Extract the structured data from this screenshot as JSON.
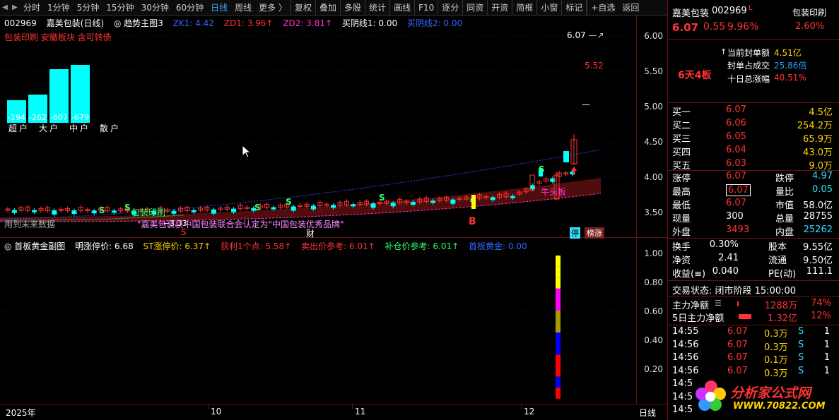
{
  "toolbar": {
    "items": [
      "分时",
      "1分钟",
      "5分钟",
      "15分钟",
      "30分钟",
      "60分钟",
      "日线",
      "周线",
      "更多 〉",
      "复权",
      "叠加",
      "多股",
      "统计",
      "画线",
      "F10",
      "逐分",
      "同资",
      "开资",
      "简框",
      "小窗",
      "标记",
      "+自选",
      "返回"
    ],
    "active_index": 6
  },
  "main_legend": {
    "code": "002969",
    "name": "嘉美包装(日线)",
    "indicator": "趋势主图3",
    "zk1": "ZK1: 4.42",
    "zd1": "ZD1: 3.96↑",
    "zd2": "ZD2: 3.81↑",
    "buy1": "买阴线1: 0.00",
    "buy2": "买阴线2: 0.00",
    "tags": "包装印刷 安徽板块 含可转债"
  },
  "volume_bars": {
    "values": [
      "-194",
      "-262",
      "-607",
      "-679"
    ],
    "labels": [
      "超户",
      "大户",
      "中户",
      "散户"
    ]
  },
  "price_axis": [
    "6.00",
    "5.50",
    "5.00",
    "4.50",
    "4.00",
    "3.50"
  ],
  "main_annotations": {
    "high_label": "6.07",
    "mark_552": "5.52",
    "low_label": "3.33",
    "news": "\"嘉美包装获中国包装联合会认定为\"中国包装优秀品牌\"",
    "future_data": "用到未来数据",
    "print_tag": "包装印刷",
    "b_marker": "B",
    "cai_marker": "财",
    "ting_badge": "停",
    "bangzhang_badge": "榜涨",
    "niu_tag": "牛头板",
    "s_marker": "S"
  },
  "sub_legend": {
    "name": "首板黄金副图",
    "mzt": "明涨停价: 6.68",
    "st": "ST涨停价: 6.37↑",
    "win": "获利1个点: 5.58↑",
    "sell": "卖出价参考: 6.01↑",
    "add": "补仓价参考: 6.01↑",
    "gold": "首板黄金: 0.00"
  },
  "sub_axis": [
    "1.00",
    "0.80",
    "0.60",
    "0.40",
    "0.20"
  ],
  "date_axis": {
    "year": "2025年",
    "m10": "10",
    "m11": "11",
    "m12": "12",
    "period": "日线"
  },
  "stock": {
    "name": "嘉美包装",
    "code": "002969",
    "flag": "L",
    "industry": "包装印刷",
    "price": "6.07",
    "change": "0.55",
    "pct": "9.96%",
    "ind_pct": "2.60%"
  },
  "limit_info": {
    "board": "6天4板",
    "seal_label": "当前封单额",
    "seal_value": "4.51亿",
    "ratio_label": "封单占成交",
    "ratio_value": "25.86倍",
    "ten_label": "十日总涨幅",
    "ten_value": "40.51%"
  },
  "order_book": [
    {
      "label": "买一",
      "price": "6.07",
      "vol": "4.5亿"
    },
    {
      "label": "买二",
      "price": "6.06",
      "vol": "254.2万"
    },
    {
      "label": "买三",
      "price": "6.05",
      "vol": "65.9万"
    },
    {
      "label": "买四",
      "price": "6.04",
      "vol": "43.0万"
    },
    {
      "label": "买五",
      "price": "6.03",
      "vol": "9.0万"
    }
  ],
  "quote": [
    {
      "l1": "涨停",
      "v1": "6.07",
      "l2": "跌停",
      "v2": "4.97"
    },
    {
      "l1": "最高",
      "v1": "6.07",
      "l2": "量比",
      "v2": "0.05"
    },
    {
      "l1": "最低",
      "v1": "6.07",
      "l2": "市值",
      "v2": "58.0亿"
    },
    {
      "l1": "现量",
      "v1": "300",
      "l2": "总量",
      "v2": "28755"
    },
    {
      "l1": "外盘",
      "v1": "3493",
      "l2": "内盘",
      "v2": "25262"
    }
  ],
  "fundamentals": [
    {
      "l1": "换手",
      "v1": "0.30%",
      "l2": "股本",
      "v2": "9.55亿"
    },
    {
      "l1": "净资",
      "v1": "2.41",
      "l2": "流通",
      "v2": "9.50亿"
    },
    {
      "l1": "收益(≡)",
      "v1": "0.040",
      "l2": "PE(动)",
      "v2": "111.1"
    }
  ],
  "trade_status": "交易状态: 闭市阶段 15:00:00",
  "capital": [
    {
      "label": "主力净额",
      "value": "1288万",
      "pct": "74%"
    },
    {
      "label": "5日主力净额",
      "value": "1.32亿",
      "pct": "12%"
    }
  ],
  "ticks": [
    {
      "time": "14:55",
      "price": "6.07",
      "vol": "0.3万",
      "side": "S",
      "n": "1"
    },
    {
      "time": "14:56",
      "price": "6.07",
      "vol": "0.3万",
      "side": "S",
      "n": "1"
    },
    {
      "time": "14:56",
      "price": "6.07",
      "vol": "0.1万",
      "side": "S",
      "n": "1"
    },
    {
      "time": "14:56",
      "price": "6.07",
      "vol": "0.3万",
      "side": "S",
      "n": "1"
    },
    {
      "time": "14:5",
      "price": "",
      "vol": "",
      "side": "",
      "n": ""
    },
    {
      "time": "14:5",
      "price": "",
      "vol": "",
      "side": "",
      "n": ""
    },
    {
      "time": "14:5",
      "price": "",
      "vol": "",
      "side": "",
      "n": ""
    }
  ],
  "watermark": {
    "title": "分析家公式网",
    "url": "WWW.70822.COM"
  }
}
